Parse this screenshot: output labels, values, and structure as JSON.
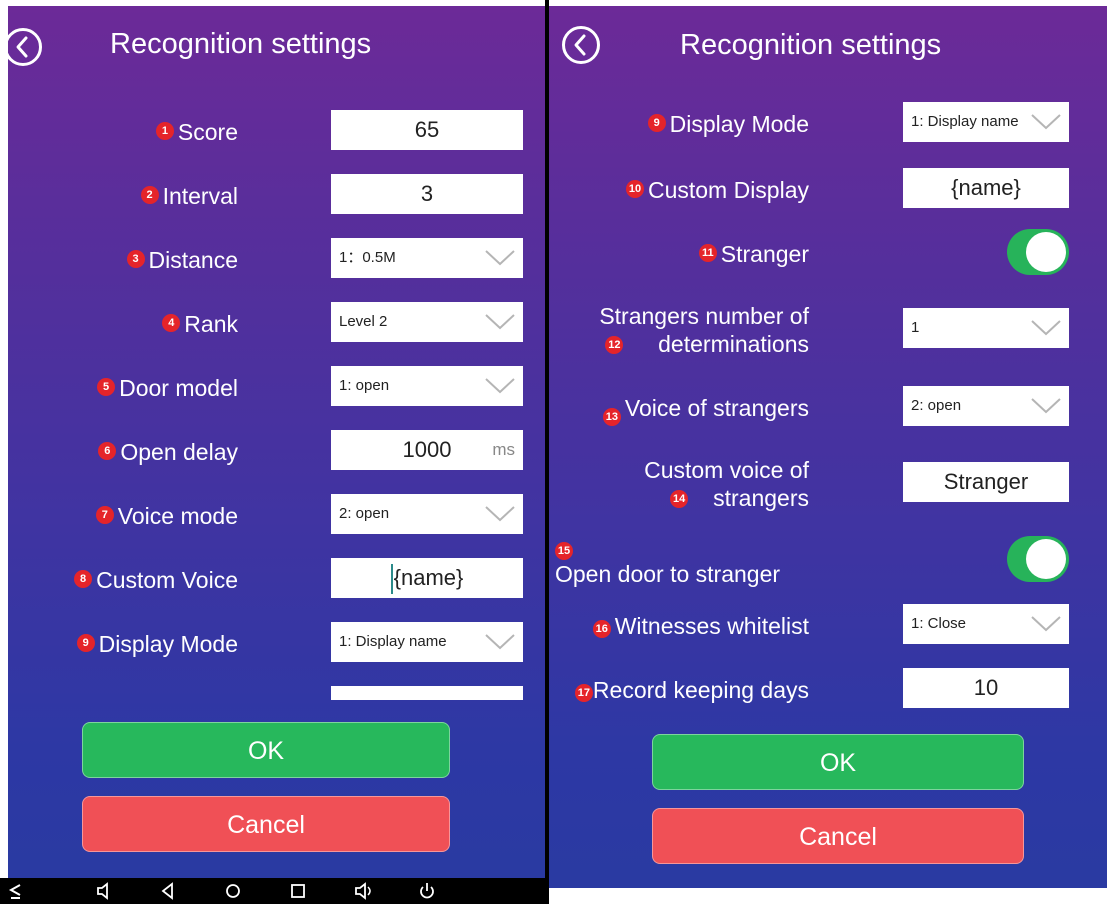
{
  "left": {
    "title": "Recognition settings",
    "rows": [
      {
        "num": "1",
        "label": "Score",
        "value": "65"
      },
      {
        "num": "2",
        "label": "Interval",
        "value": "3"
      },
      {
        "num": "3",
        "label": "Distance",
        "value": "1：0.5M"
      },
      {
        "num": "4",
        "label": "Rank",
        "value": "Level 2"
      },
      {
        "num": "5",
        "label": "Door model",
        "value": "1: open"
      },
      {
        "num": "6",
        "label": "Open delay",
        "value": "1000",
        "unit": "ms"
      },
      {
        "num": "7",
        "label": "Voice mode",
        "value": "2: open"
      },
      {
        "num": "8",
        "label": "Custom Voice",
        "value": "{name}"
      },
      {
        "num": "9",
        "label": "Display Mode",
        "value": "1: Display name"
      }
    ],
    "ok": "OK",
    "cancel": "Cancel"
  },
  "right": {
    "title": "Recognition settings",
    "rows": [
      {
        "num": "9",
        "label": "Display Mode",
        "value": "1: Display name"
      },
      {
        "num": "10",
        "label": "Custom Display",
        "value": "{name}"
      },
      {
        "num": "11",
        "label": "Stranger",
        "value": "on"
      },
      {
        "num": "12",
        "label_1": "Strangers number of",
        "label_2": "determinations",
        "value": "1"
      },
      {
        "num": "13",
        "label": "Voice of strangers",
        "value": "2: open"
      },
      {
        "num": "14",
        "label_1": "Custom voice of",
        "label_2": "strangers",
        "value": "Stranger"
      },
      {
        "num": "15",
        "label": "Open door to stranger",
        "value": "on"
      },
      {
        "num": "16",
        "label": "Witnesses whitelist",
        "value": "1: Close"
      },
      {
        "num": "17",
        "label": "Record keeping days",
        "value": "10"
      }
    ],
    "ok": "OK",
    "cancel": "Cancel"
  },
  "icons": {
    "back": "back-arrow-icon",
    "dropdown": "chevron-down-icon",
    "nav": [
      "menu-icon",
      "volume-down-icon",
      "back-icon",
      "home-icon",
      "recents-icon",
      "volume-up-icon",
      "power-icon"
    ]
  },
  "colors": {
    "ok": "#27b85c",
    "cancel": "#f05056",
    "toggle_on": "#27b35a",
    "badge": "#e5242a"
  }
}
